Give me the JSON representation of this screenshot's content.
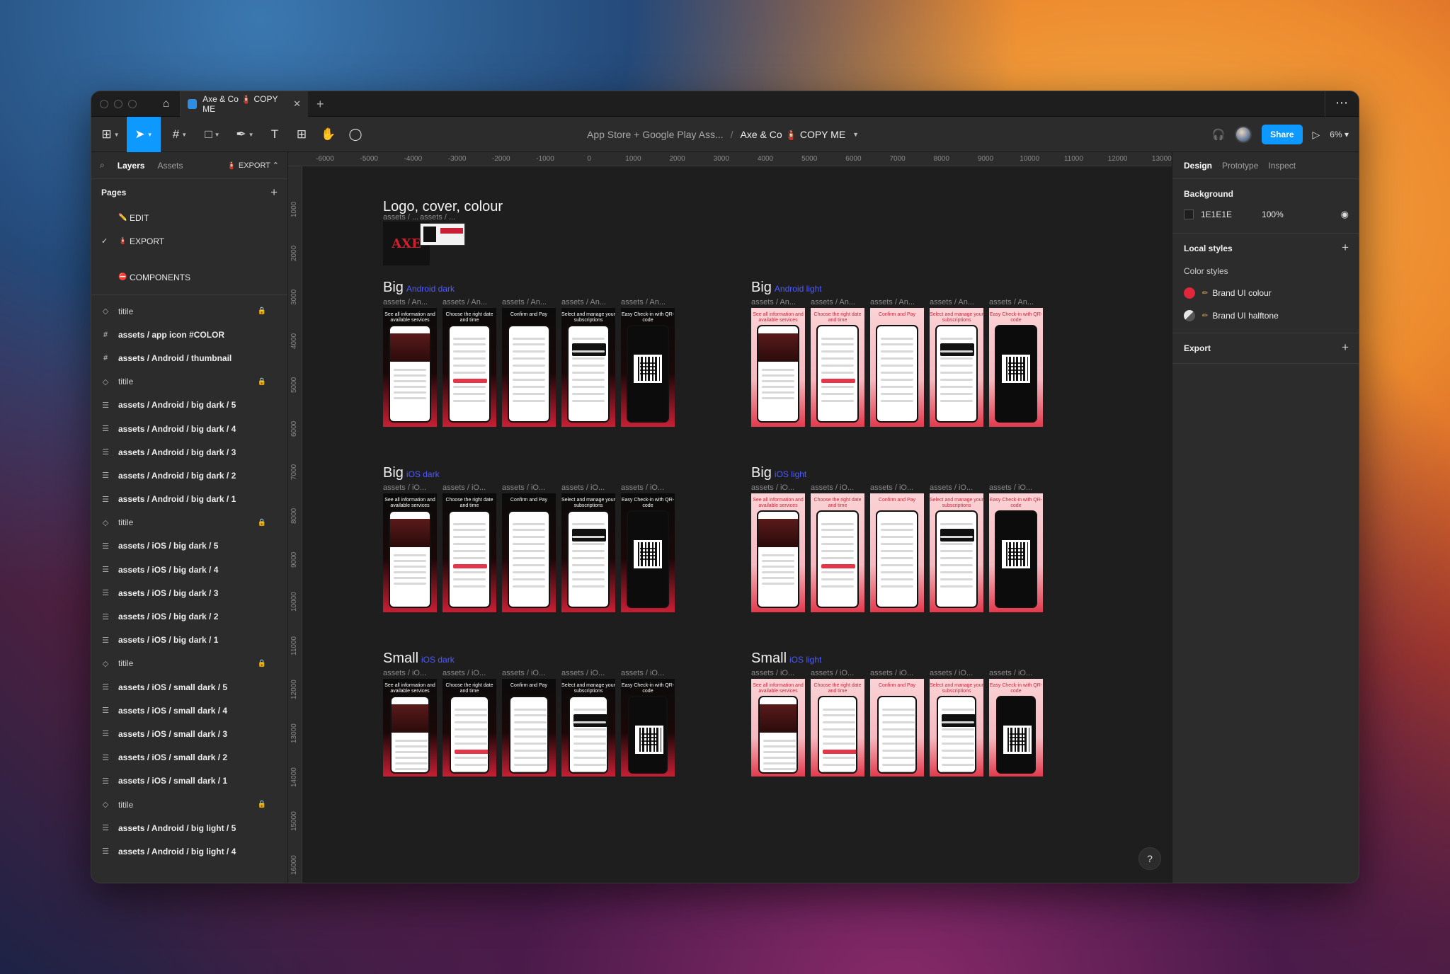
{
  "tabbar": {
    "tab_title": "Axe & Co 🧯 COPY ME"
  },
  "toolbar": {
    "breadcrumb_project": "App Store + Google Play Ass...",
    "breadcrumb_separator": "/",
    "breadcrumb_file": "Axe & Co 🧯 COPY ME",
    "share_label": "Share",
    "zoom": "6%"
  },
  "left_panel": {
    "tab_layers": "Layers",
    "tab_assets": "Assets",
    "current_page": "EXPORT",
    "pages_heading": "Pages",
    "pages": [
      {
        "label": "EDIT",
        "icon": "✏️",
        "selected": false
      },
      {
        "label": "EXPORT",
        "icon": "🧯",
        "selected": true
      },
      {
        "label": "",
        "icon": "",
        "selected": false
      },
      {
        "label": "COMPONENTS",
        "icon": "⛔",
        "selected": false
      }
    ],
    "layers": [
      {
        "label": "titile",
        "type": "component",
        "locked": true
      },
      {
        "label": "assets / app icon #COLOR",
        "type": "frame",
        "locked": false
      },
      {
        "label": "assets / Android / thumbnail",
        "type": "frame",
        "locked": false
      },
      {
        "label": "titile",
        "type": "component",
        "locked": true
      },
      {
        "label": "assets / Android / big dark / 5",
        "type": "autolayout",
        "locked": false
      },
      {
        "label": "assets / Android / big dark / 4",
        "type": "autolayout",
        "locked": false
      },
      {
        "label": "assets / Android / big dark / 3",
        "type": "autolayout",
        "locked": false
      },
      {
        "label": "assets / Android / big dark / 2",
        "type": "autolayout",
        "locked": false
      },
      {
        "label": "assets / Android / big dark / 1",
        "type": "autolayout",
        "locked": false
      },
      {
        "label": "titile",
        "type": "component",
        "locked": true
      },
      {
        "label": "assets / iOS / big dark / 5",
        "type": "autolayout",
        "locked": false
      },
      {
        "label": "assets / iOS / big dark / 4",
        "type": "autolayout",
        "locked": false
      },
      {
        "label": "assets / iOS / big dark / 3",
        "type": "autolayout",
        "locked": false
      },
      {
        "label": "assets / iOS / big dark / 2",
        "type": "autolayout",
        "locked": false
      },
      {
        "label": "assets / iOS / big dark / 1",
        "type": "autolayout",
        "locked": false
      },
      {
        "label": "titile",
        "type": "component",
        "locked": true
      },
      {
        "label": "assets / iOS / small dark / 5",
        "type": "autolayout",
        "locked": false
      },
      {
        "label": "assets / iOS / small dark / 4",
        "type": "autolayout",
        "locked": false
      },
      {
        "label": "assets / iOS / small dark / 3",
        "type": "autolayout",
        "locked": false
      },
      {
        "label": "assets / iOS / small dark / 2",
        "type": "autolayout",
        "locked": false
      },
      {
        "label": "assets / iOS / small dark / 1",
        "type": "autolayout",
        "locked": false
      },
      {
        "label": "titile",
        "type": "component",
        "locked": true
      },
      {
        "label": "assets / Android / big light / 5",
        "type": "autolayout",
        "locked": false
      },
      {
        "label": "assets / Android / big light / 4",
        "type": "autolayout",
        "locked": false
      }
    ]
  },
  "canvas": {
    "ruler_top": [
      "-6000",
      "-5000",
      "-4000",
      "-3000",
      "-2000",
      "-1000",
      "0",
      "1000",
      "2000",
      "3000",
      "4000",
      "5000",
      "6000",
      "7000",
      "8000",
      "9000",
      "10000",
      "11000",
      "12000",
      "13000"
    ],
    "ruler_left": [
      "1000",
      "2000",
      "3000",
      "4000",
      "5000",
      "6000",
      "7000",
      "8000",
      "9000",
      "10000",
      "11000",
      "12000",
      "13000",
      "14000",
      "15000",
      "16000"
    ],
    "logo_section": {
      "title": "Logo, cover, colour",
      "labels": [
        "assets / ...",
        "assets / ..."
      ],
      "logo_text": "AXE"
    },
    "sections": [
      {
        "title": "Big",
        "sub": "Android dark",
        "theme": "dark",
        "label": "assets / An..."
      },
      {
        "title": "Big",
        "sub": "Android light",
        "theme": "light",
        "label": "assets / An..."
      },
      {
        "title": "Big",
        "sub": "iOS dark",
        "theme": "dark",
        "label": "assets / iO..."
      },
      {
        "title": "Big",
        "sub": "iOS light",
        "theme": "light",
        "label": "assets / iO..."
      },
      {
        "title": "Small",
        "sub": "iOS dark",
        "theme": "dark",
        "label": "assets / iO..."
      },
      {
        "title": "Small",
        "sub": "iOS light",
        "theme": "light",
        "label": "assets / iO..."
      }
    ],
    "screen_captions": [
      "See all information and available services",
      "Choose the right date and time",
      "Confirm and Pay",
      "Select and manage your subscriptions",
      "Easy Check-in with QR-code"
    ],
    "help_label": "?"
  },
  "right_panel": {
    "tab_design": "Design",
    "tab_prototype": "Prototype",
    "tab_inspect": "Inspect",
    "background_heading": "Background",
    "background_hex": "1E1E1E",
    "background_opacity": "100%",
    "local_styles_heading": "Local styles",
    "color_styles_heading": "Color styles",
    "styles": [
      {
        "name": "Brand UI colour",
        "color": "#e0263a"
      },
      {
        "name": "Brand UI halftone",
        "color": "#d8d8d8"
      }
    ],
    "export_heading": "Export"
  },
  "colors": {
    "accent": "#0d99ff",
    "brand_red": "#e0263a",
    "canvas_bg": "#1e1e1e",
    "ios_sub": "#4d5bff"
  }
}
